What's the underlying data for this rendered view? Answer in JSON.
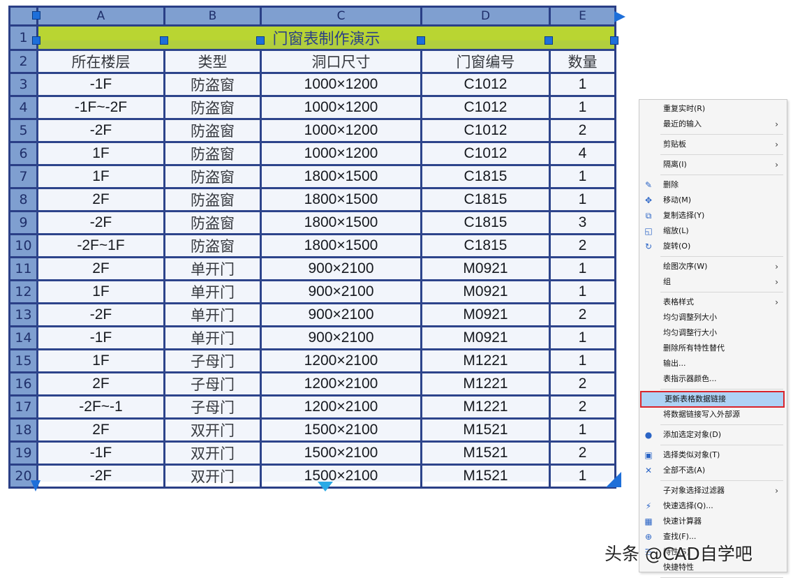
{
  "sheet": {
    "column_headers": [
      "A",
      "B",
      "C",
      "D",
      "E"
    ],
    "title": "门窗表制作演示",
    "field_headers": [
      "所在楼层",
      "类型",
      "洞口尺寸",
      "门窗编号",
      "数量"
    ],
    "rows": [
      [
        "-1F",
        "防盗窗",
        "1000×1200",
        "C1012",
        "1"
      ],
      [
        "-1F~-2F",
        "防盗窗",
        "1000×1200",
        "C1012",
        "1"
      ],
      [
        "-2F",
        "防盗窗",
        "1000×1200",
        "C1012",
        "2"
      ],
      [
        "1F",
        "防盗窗",
        "1000×1200",
        "C1012",
        "4"
      ],
      [
        "1F",
        "防盗窗",
        "1800×1500",
        "C1815",
        "1"
      ],
      [
        "2F",
        "防盗窗",
        "1800×1500",
        "C1815",
        "1"
      ],
      [
        "-2F",
        "防盗窗",
        "1800×1500",
        "C1815",
        "3"
      ],
      [
        "-2F~1F",
        "防盗窗",
        "1800×1500",
        "C1815",
        "2"
      ],
      [
        "2F",
        "单开门",
        "900×2100",
        "M0921",
        "1"
      ],
      [
        "1F",
        "单开门",
        "900×2100",
        "M0921",
        "1"
      ],
      [
        "-2F",
        "单开门",
        "900×2100",
        "M0921",
        "2"
      ],
      [
        "-1F",
        "单开门",
        "900×2100",
        "M0921",
        "1"
      ],
      [
        "1F",
        "子母门",
        "1200×2100",
        "M1221",
        "1"
      ],
      [
        "2F",
        "子母门",
        "1200×2100",
        "M1221",
        "2"
      ],
      [
        "-2F~-1",
        "子母门",
        "1200×2100",
        "M1221",
        "2"
      ],
      [
        "2F",
        "双开门",
        "1500×2100",
        "M1521",
        "1"
      ],
      [
        "-1F",
        "双开门",
        "1500×2100",
        "M1521",
        "2"
      ],
      [
        "-2F",
        "双开门",
        "1500×2100",
        "M1521",
        "1"
      ]
    ],
    "row_numbers": [
      "1",
      "2",
      "3",
      "4",
      "5",
      "6",
      "7",
      "8",
      "9",
      "10",
      "11",
      "12",
      "13",
      "14",
      "15",
      "16",
      "17",
      "18",
      "19",
      "20"
    ]
  },
  "colors": {
    "title_bg": "#b9d532",
    "header_bg": "#7f9fd0",
    "grid_border": "#2a3f86",
    "grip": "#1e6fd9",
    "highlight": "#aed2f5",
    "highlight_border": "#d9242b"
  },
  "context_menu": {
    "items": [
      {
        "label": "重复实时(R)",
        "submenu": false,
        "icon": ""
      },
      {
        "label": "最近的输入",
        "submenu": true,
        "icon": ""
      },
      {
        "label": "剪贴板",
        "submenu": true,
        "icon": ""
      },
      {
        "label": "隔离(I)",
        "submenu": true,
        "icon": ""
      },
      {
        "label": "删除",
        "submenu": false,
        "icon": "eraser-icon"
      },
      {
        "label": "移动(M)",
        "submenu": false,
        "icon": "move-icon"
      },
      {
        "label": "复制选择(Y)",
        "submenu": false,
        "icon": "copy-icon"
      },
      {
        "label": "缩放(L)",
        "submenu": false,
        "icon": "scale-icon"
      },
      {
        "label": "旋转(O)",
        "submenu": false,
        "icon": "rotate-icon"
      },
      {
        "label": "绘图次序(W)",
        "submenu": true,
        "icon": ""
      },
      {
        "label": "组",
        "submenu": true,
        "icon": ""
      },
      {
        "label": "表格样式",
        "submenu": true,
        "icon": ""
      },
      {
        "label": "均匀调整列大小",
        "submenu": false,
        "icon": ""
      },
      {
        "label": "均匀调整行大小",
        "submenu": false,
        "icon": ""
      },
      {
        "label": "删除所有特性替代",
        "submenu": false,
        "icon": ""
      },
      {
        "label": "输出...",
        "submenu": false,
        "icon": ""
      },
      {
        "label": "表指示器颜色...",
        "submenu": false,
        "icon": ""
      },
      {
        "label": "更新表格数据链接",
        "submenu": false,
        "icon": "",
        "highlighted": true
      },
      {
        "label": "将数据链接写入外部源",
        "submenu": false,
        "icon": ""
      },
      {
        "label": "添加选定对象(D)",
        "submenu": false,
        "icon": "add-selected-icon"
      },
      {
        "label": "选择类似对象(T)",
        "submenu": false,
        "icon": "select-similar-icon"
      },
      {
        "label": "全部不选(A)",
        "submenu": false,
        "icon": "deselect-all-icon"
      },
      {
        "label": "子对象选择过滤器",
        "submenu": true,
        "icon": ""
      },
      {
        "label": "快速选择(Q)...",
        "submenu": false,
        "icon": "quick-select-icon"
      },
      {
        "label": "快速计算器",
        "submenu": false,
        "icon": "calculator-icon"
      },
      {
        "label": "查找(F)...",
        "submenu": false,
        "icon": "find-icon"
      },
      {
        "label": "特性(S)",
        "submenu": false,
        "icon": "properties-icon"
      },
      {
        "label": "快捷特性",
        "submenu": false,
        "icon": ""
      }
    ],
    "submenu_arrow": "›"
  },
  "watermark": "头条 @CAD自学吧"
}
